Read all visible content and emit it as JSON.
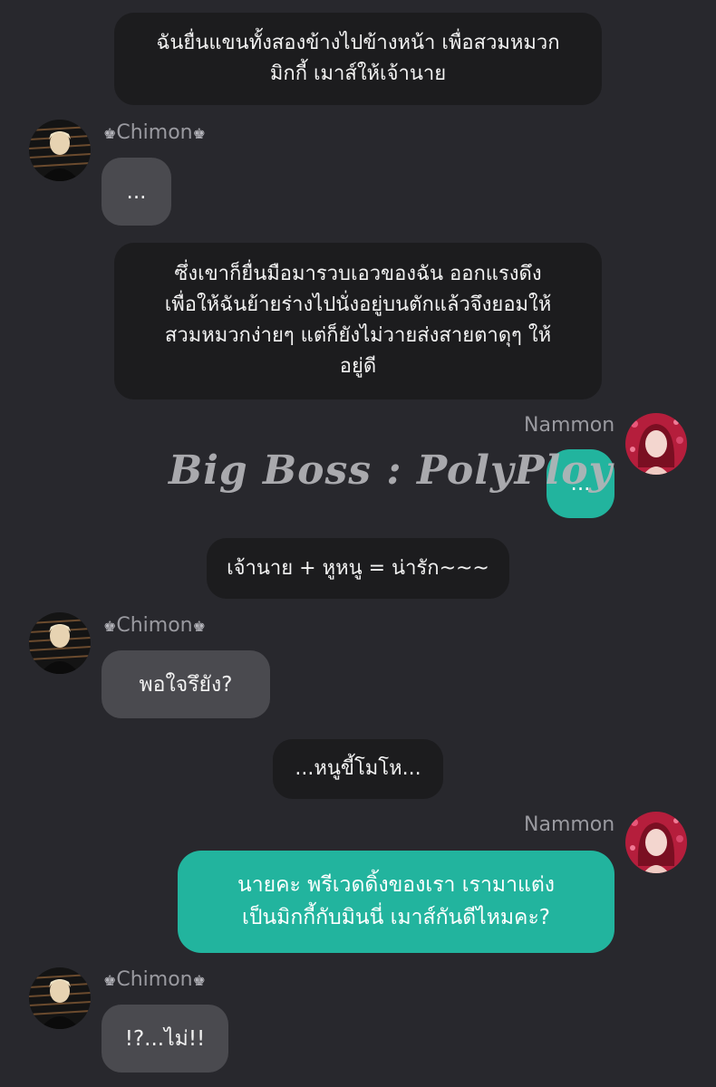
{
  "narration": [
    {
      "lines": [
        "ฉันยื่นแขนทั้งสองข้างไปข้างหน้า เพื่อสวมหมวก",
        "มิกกี้ เมาส์ให้เจ้านาย"
      ]
    },
    {
      "lines": [
        "ซึ่งเขาก็ยื่นมือมารวบเอวของฉัน ออกแรงดึง",
        "เพื่อให้ฉันย้ายร่างไปนั่งอยู่บนตักแล้วจึงยอมให้",
        "สวมหมวกง่ายๆ แต่ก็ยังไม่วายส่งสายตาดุๆ ให้",
        "อยู่ดี"
      ]
    },
    {
      "lines": [
        "เจ้านาย + หูหนู = น่ารัก~~~"
      ]
    },
    {
      "lines": [
        "...หนูขี้โมโห..."
      ]
    }
  ],
  "chimon": {
    "name": "Chimon",
    "crown": "♚",
    "messages": [
      "...",
      "พอใจรึยัง?",
      "!?...ไม่!!"
    ]
  },
  "nammon": {
    "name": "Nammon",
    "messages": [
      "...",
      "นายคะ พรีเวดดิ้งของเรา เรามาแต่ง",
      "เป็นมิกกี้กับมินนี่ เมาส์กันดีไหมคะ?"
    ]
  },
  "watermark": "Big Boss : PolyPloy",
  "colors": {
    "background": "#28282d",
    "narration_bubble": "#1c1c1e",
    "left_bubble": "#4a4a4f",
    "right_bubble": "#22b49e"
  }
}
